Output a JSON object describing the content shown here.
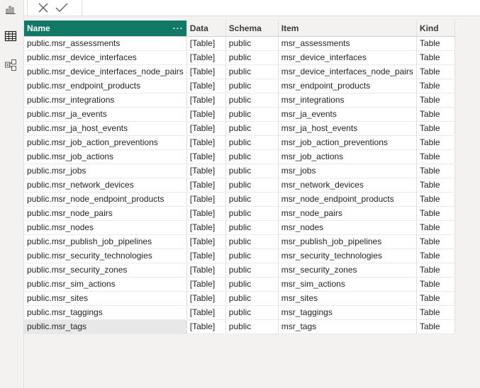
{
  "sidebar": {
    "icons": [
      "report-view-icon",
      "table-view-icon",
      "model-view-icon"
    ]
  },
  "formula_bar": {
    "cancel_icon": "close-icon",
    "commit_icon": "checkmark-icon",
    "value": ""
  },
  "table": {
    "columns": [
      "Name",
      "Data",
      "Schema",
      "Item",
      "Kind"
    ],
    "selected_column": "Name",
    "column_menu_label": "···",
    "rows": [
      [
        "public.msr_assessments",
        "[Table]",
        "public",
        "msr_assessments",
        "Table"
      ],
      [
        "public.msr_device_interfaces",
        "[Table]",
        "public",
        "msr_device_interfaces",
        "Table"
      ],
      [
        "public.msr_device_interfaces_node_pairs",
        "[Table]",
        "public",
        "msr_device_interfaces_node_pairs",
        "Table"
      ],
      [
        "public.msr_endpoint_products",
        "[Table]",
        "public",
        "msr_endpoint_products",
        "Table"
      ],
      [
        "public.msr_integrations",
        "[Table]",
        "public",
        "msr_integrations",
        "Table"
      ],
      [
        "public.msr_ja_events",
        "[Table]",
        "public",
        "msr_ja_events",
        "Table"
      ],
      [
        "public.msr_ja_host_events",
        "[Table]",
        "public",
        "msr_ja_host_events",
        "Table"
      ],
      [
        "public.msr_job_action_preventions",
        "[Table]",
        "public",
        "msr_job_action_preventions",
        "Table"
      ],
      [
        "public.msr_job_actions",
        "[Table]",
        "public",
        "msr_job_actions",
        "Table"
      ],
      [
        "public.msr_jobs",
        "[Table]",
        "public",
        "msr_jobs",
        "Table"
      ],
      [
        "public.msr_network_devices",
        "[Table]",
        "public",
        "msr_network_devices",
        "Table"
      ],
      [
        "public.msr_node_endpoint_products",
        "[Table]",
        "public",
        "msr_node_endpoint_products",
        "Table"
      ],
      [
        "public.msr_node_pairs",
        "[Table]",
        "public",
        "msr_node_pairs",
        "Table"
      ],
      [
        "public.msr_nodes",
        "[Table]",
        "public",
        "msr_nodes",
        "Table"
      ],
      [
        "public.msr_publish_job_pipelines",
        "[Table]",
        "public",
        "msr_publish_job_pipelines",
        "Table"
      ],
      [
        "public.msr_security_technologies",
        "[Table]",
        "public",
        "msr_security_technologies",
        "Table"
      ],
      [
        "public.msr_security_zones",
        "[Table]",
        "public",
        "msr_security_zones",
        "Table"
      ],
      [
        "public.msr_sim_actions",
        "[Table]",
        "public",
        "msr_sim_actions",
        "Table"
      ],
      [
        "public.msr_sites",
        "[Table]",
        "public",
        "msr_sites",
        "Table"
      ],
      [
        "public.msr_taggings",
        "[Table]",
        "public",
        "msr_taggings",
        "Table"
      ],
      [
        "public.msr_tags",
        "[Table]",
        "public",
        "msr_tags",
        "Table"
      ]
    ]
  },
  "colors": {
    "selected_header": "#117865",
    "hover_row": "#e8e8e8",
    "background": "#f3f2f1"
  }
}
